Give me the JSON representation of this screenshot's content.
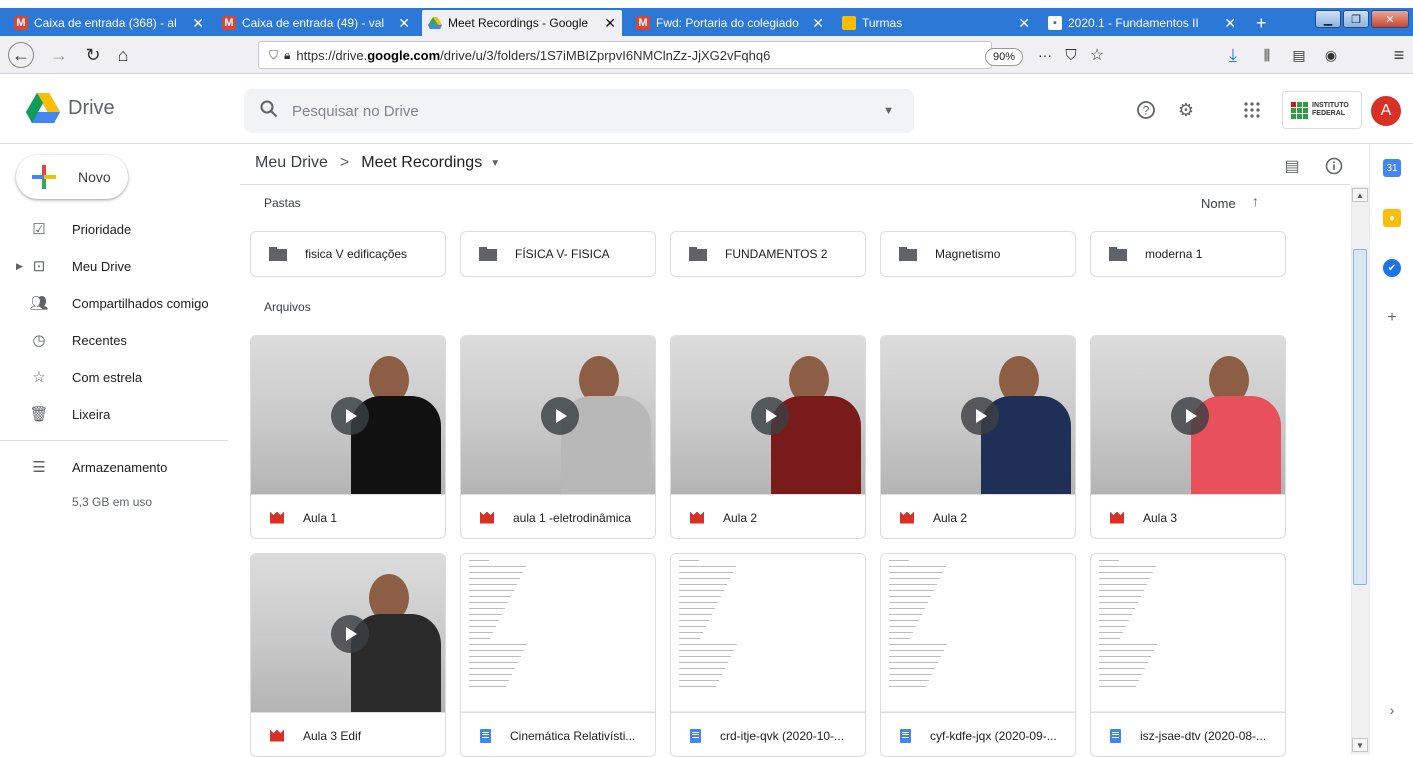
{
  "browser": {
    "tabs": [
      {
        "title": "Caixa de entrada (368) - al",
        "icon": "gmail-icon"
      },
      {
        "title": "Caixa de entrada (49) - val",
        "icon": "gmail-icon"
      },
      {
        "title": "Meet Recordings - Google",
        "icon": "drive-icon",
        "active": true
      },
      {
        "title": "Fwd: Portaria do colegiado",
        "icon": "gmail-icon"
      },
      {
        "title": "Turmas",
        "icon": "classroom-icon"
      },
      {
        "title": "2020.1 - Fundamentos II",
        "icon": "classroom-icon"
      }
    ],
    "url": "https://drive.google.com/drive/u/3/folders/1S7iMBIZprpvI6NMClnZz-JjXG2vFqhq6",
    "url_bold": "google.com",
    "zoom": "90%"
  },
  "header": {
    "app_name": "Drive",
    "search_placeholder": "Pesquisar no Drive",
    "avatar_letter": "A",
    "institution": [
      "INSTITUTO",
      "FEDERAL"
    ]
  },
  "sidebar": {
    "new_label": "Novo",
    "items": [
      {
        "label": "Prioridade",
        "icon": "priority-icon"
      },
      {
        "label": "Meu Drive",
        "icon": "my-drive-icon"
      },
      {
        "label": "Compartilhados comigo",
        "icon": "shared-icon"
      },
      {
        "label": "Recentes",
        "icon": "clock-icon"
      },
      {
        "label": "Com estrela",
        "icon": "star-icon"
      },
      {
        "label": "Lixeira",
        "icon": "trash-icon"
      }
    ],
    "storage_label": "Armazenamento",
    "storage_usage": "5,3 GB em uso"
  },
  "main": {
    "breadcrumb": [
      "Meu Drive",
      "Meet Recordings"
    ],
    "folders_label": "Pastas",
    "files_label": "Arquivos",
    "sort_label": "Nome",
    "folders": [
      "fisica V edificações",
      "FÍSICA V- FISICA",
      "FUNDAMENTOS 2",
      "Magnetismo",
      "moderna 1"
    ],
    "files": [
      {
        "name": "Aula 1",
        "type": "video"
      },
      {
        "name": "aula 1 -eletrodinâmica",
        "type": "video"
      },
      {
        "name": "Aula 2",
        "type": "video"
      },
      {
        "name": "Aula 2",
        "type": "video"
      },
      {
        "name": "Aula 3",
        "type": "video"
      },
      {
        "name": "Aula 3 Edif",
        "type": "video"
      },
      {
        "name": "Cinemática Relativísti...",
        "type": "doc"
      },
      {
        "name": "crd-itje-qvk (2020-10-...",
        "type": "doc"
      },
      {
        "name": "cyf-kdfe-jqx (2020-09-...",
        "type": "doc"
      },
      {
        "name": "isz-jsae-dtv (2020-08-...",
        "type": "doc"
      }
    ]
  },
  "colors": {
    "tabbar": "#2b78d6",
    "drive_yellow": "#fbbc04",
    "drive_green": "#34a853",
    "drive_blue": "#4285f4",
    "video_red": "#d93025"
  }
}
